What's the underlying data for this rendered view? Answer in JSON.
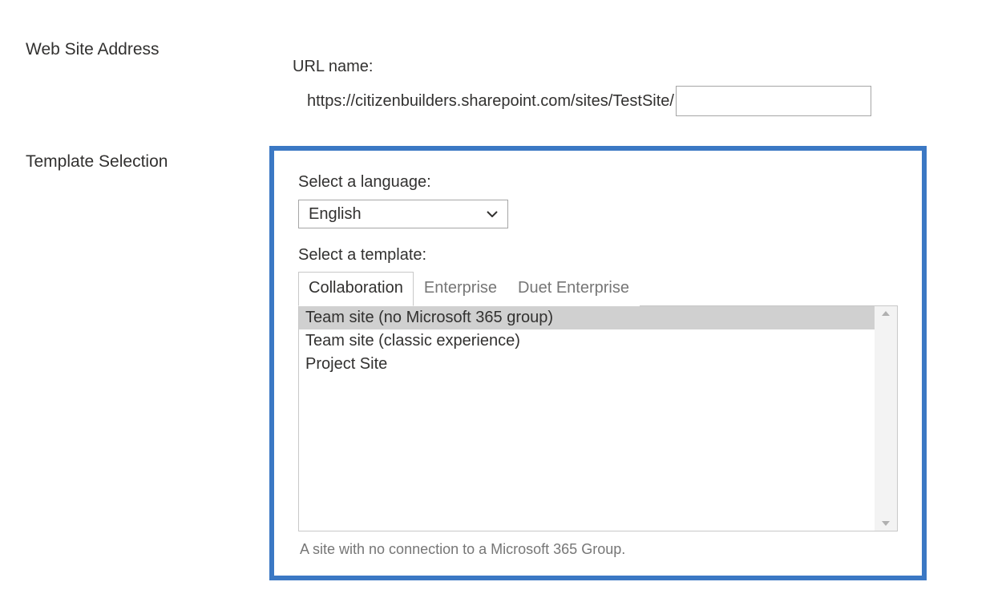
{
  "sections": {
    "address_label": "Web Site Address",
    "template_label": "Template Selection"
  },
  "url": {
    "label": "URL name:",
    "prefix": "https://citizenbuilders.sharepoint.com/sites/TestSite/",
    "value": ""
  },
  "template": {
    "language_label": "Select a language:",
    "language_value": "English",
    "template_label": "Select a template:",
    "tabs": [
      {
        "label": "Collaboration",
        "active": true
      },
      {
        "label": "Enterprise",
        "active": false
      },
      {
        "label": "Duet Enterprise",
        "active": false
      }
    ],
    "items": [
      {
        "label": "Team site (no Microsoft 365 group)",
        "selected": true
      },
      {
        "label": "Team site (classic experience)",
        "selected": false
      },
      {
        "label": "Project Site",
        "selected": false
      }
    ],
    "description": "A site with no connection to a Microsoft 365 Group."
  }
}
